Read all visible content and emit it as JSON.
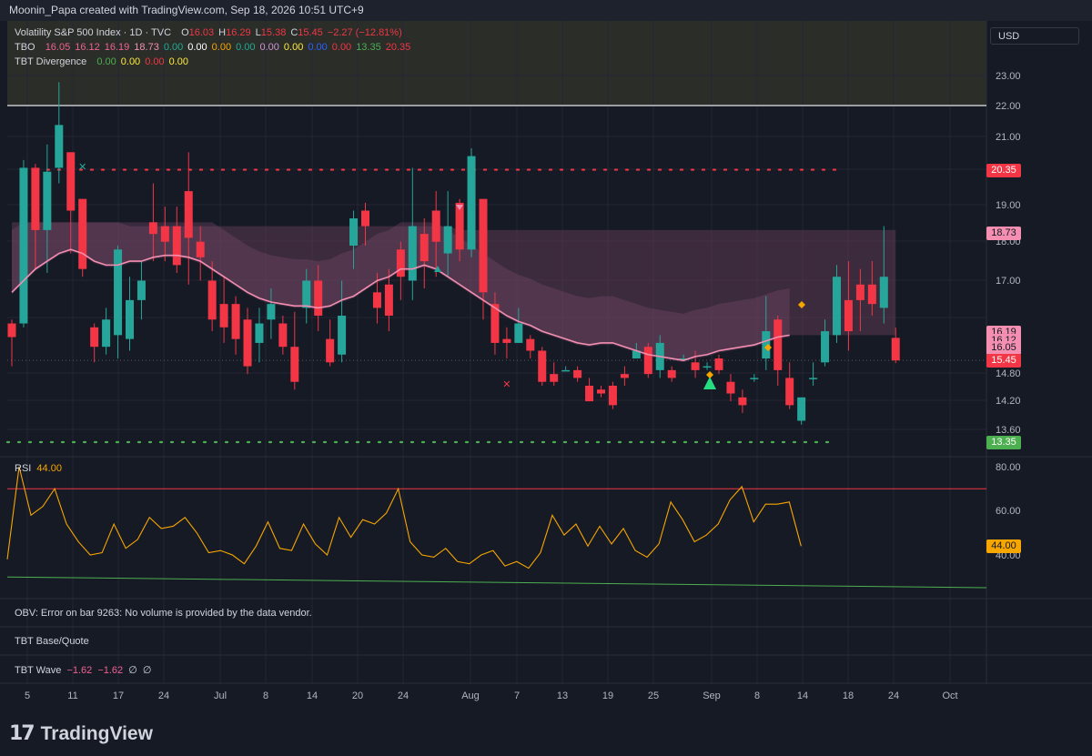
{
  "header": {
    "created_by": "Moonin_Papa created with TradingView.com, Sep 18, 2026 10:51 UTC+9"
  },
  "currency_button": "USD",
  "legend": {
    "main": {
      "title": "Volatility S&P 500 Index · 1D · TVC",
      "items": [
        {
          "label": "O",
          "value": "16.03",
          "color": "#f23645"
        },
        {
          "label": "H",
          "value": "16.29",
          "color": "#f23645"
        },
        {
          "label": "L",
          "value": "15.38",
          "color": "#f23645"
        },
        {
          "label": "C",
          "value": "15.45",
          "color": "#f23645"
        },
        {
          "label": "",
          "value": "−2.27 (−12.81%)",
          "color": "#f23645"
        }
      ]
    },
    "tbo": {
      "name": "TBO",
      "values": [
        {
          "v": "16.05",
          "color": "#f06292"
        },
        {
          "v": "16.12",
          "color": "#f06292"
        },
        {
          "v": "16.19",
          "color": "#f06292"
        },
        {
          "v": "18.73",
          "color": "#f48fb1"
        },
        {
          "v": "0.00",
          "color": "#22ab94"
        },
        {
          "v": "0.00",
          "color": "#ffffff"
        },
        {
          "v": "0.00",
          "color": "#f7a600"
        },
        {
          "v": "0.00",
          "color": "#22ab94"
        },
        {
          "v": "0.00",
          "color": "#ce93d8"
        },
        {
          "v": "0.00",
          "color": "#ffeb3b"
        },
        {
          "v": "0.00",
          "color": "#2962ff"
        },
        {
          "v": "0.00",
          "color": "#f23645"
        },
        {
          "v": "13.35",
          "color": "#4caf50"
        },
        {
          "v": "20.35",
          "color": "#f23645"
        }
      ]
    },
    "divergence": {
      "name": "TBT Divergence",
      "values": [
        {
          "v": "0.00",
          "color": "#4caf50"
        },
        {
          "v": "0.00",
          "color": "#ffeb3b"
        },
        {
          "v": "0.00",
          "color": "#f23645"
        },
        {
          "v": "0.00",
          "color": "#ffeb3b"
        }
      ]
    }
  },
  "rsi": {
    "name": "RSI",
    "value": "44.00"
  },
  "panes": {
    "obv": "OBV: Error on bar 9263: No volume is provided by the data vendor.",
    "base_quote": "TBT Base/Quote",
    "wave": {
      "name": "TBT Wave",
      "v1": "−1.62",
      "v2": "−1.62",
      "v3": "∅",
      "v4": "∅"
    }
  },
  "footer": {
    "brand": "TradingView",
    "mark": "17"
  },
  "chart_data": {
    "type": "candlestick",
    "symbol": "Volatility S&P 500 Index · 1D · TVC",
    "price_axis": {
      "ticks": [
        "23.00",
        "22.00",
        "21.00",
        "20.00",
        "19.00",
        "18.00",
        "17.00",
        "14.80",
        "14.20",
        "13.60"
      ]
    },
    "x_ticks": [
      {
        "label": "5",
        "index": 1
      },
      {
        "label": "11",
        "index": 5
      },
      {
        "label": "17",
        "index": 9
      },
      {
        "label": "24",
        "index": 13
      },
      {
        "label": "Jul",
        "index": 16
      },
      {
        "label": "8",
        "index": 20
      },
      {
        "label": "14",
        "index": 24
      },
      {
        "label": "20",
        "index": 28
      },
      {
        "label": "24",
        "index": 31
      },
      {
        "label": "Aug",
        "index": 37
      },
      {
        "label": "7",
        "index": 40
      },
      {
        "label": "13",
        "index": 44
      },
      {
        "label": "19",
        "index": 48
      },
      {
        "label": "25",
        "index": 52
      },
      {
        "label": "Sep",
        "index": 56
      },
      {
        "label": "8",
        "index": 60
      },
      {
        "label": "14",
        "index": 64
      },
      {
        "label": "18",
        "index": 67
      },
      {
        "label": "24",
        "index": 71
      },
      {
        "label": "Oct",
        "index": 76
      }
    ],
    "candles": [
      [
        16.4,
        16.05,
        16.5,
        15.3
      ],
      [
        16.4,
        20.4,
        20.6,
        16.3
      ],
      [
        20.4,
        18.8,
        20.5,
        17.8
      ],
      [
        18.8,
        20.3,
        21.0,
        17.7
      ],
      [
        20.4,
        21.5,
        22.6,
        20.0
      ],
      [
        20.8,
        19.3,
        20.8,
        18.2
      ],
      [
        19.6,
        17.8,
        19.6,
        17.6
      ],
      [
        16.3,
        15.8,
        16.4,
        15.4
      ],
      [
        15.8,
        16.5,
        16.8,
        15.6
      ],
      [
        16.1,
        18.3,
        18.4,
        15.5
      ],
      [
        16.0,
        17.0,
        17.6,
        15.7
      ],
      [
        17.0,
        17.5,
        18.0,
        16.5
      ],
      [
        19.0,
        18.7,
        20.0,
        18.0
      ],
      [
        18.9,
        18.5,
        19.4,
        18.0
      ],
      [
        18.9,
        17.9,
        19.4,
        17.7
      ],
      [
        19.8,
        18.6,
        20.8,
        17.4
      ],
      [
        18.5,
        18.1,
        18.9,
        17.5
      ],
      [
        17.5,
        16.5,
        18.0,
        16.2
      ],
      [
        16.9,
        16.3,
        17.6,
        15.9
      ],
      [
        16.9,
        16.0,
        17.1,
        15.6
      ],
      [
        16.5,
        15.3,
        16.8,
        15.1
      ],
      [
        15.9,
        16.4,
        16.8,
        15.4
      ],
      [
        16.5,
        16.9,
        17.3,
        16.0
      ],
      [
        16.4,
        15.8,
        16.6,
        15.6
      ],
      [
        15.8,
        14.9,
        16.7,
        14.7
      ],
      [
        16.8,
        17.5,
        17.8,
        16.4
      ],
      [
        17.5,
        16.6,
        17.9,
        16.2
      ],
      [
        16.0,
        15.4,
        16.5,
        15.3
      ],
      [
        15.6,
        16.6,
        17.5,
        15.4
      ],
      [
        18.4,
        19.1,
        19.3,
        17.8
      ],
      [
        19.3,
        18.9,
        19.5,
        18.4
      ],
      [
        17.2,
        16.8,
        17.7,
        16.4
      ],
      [
        17.4,
        16.6,
        17.8,
        16.2
      ],
      [
        18.3,
        17.6,
        18.5,
        17.0
      ],
      [
        17.5,
        18.9,
        20.4,
        17.0
      ],
      [
        18.7,
        18.0,
        19.1,
        17.3
      ],
      [
        19.3,
        18.5,
        19.8,
        17.6
      ],
      [
        18.2,
        18.9,
        19.8,
        17.6
      ],
      [
        19.5,
        18.3,
        19.6,
        18.0
      ],
      [
        18.3,
        20.7,
        20.9,
        18.1
      ],
      [
        19.6,
        17.2,
        19.6,
        16.5
      ],
      [
        16.9,
        15.9,
        17.2,
        15.6
      ],
      [
        16.0,
        15.9,
        16.3,
        15.5
      ],
      [
        15.9,
        16.4,
        16.8,
        15.9
      ],
      [
        16.0,
        15.7,
        16.1,
        15.5
      ],
      [
        15.7,
        14.9,
        15.8,
        14.8
      ],
      [
        15.1,
        14.9,
        15.4,
        14.8
      ],
      [
        15.2,
        15.2,
        15.3,
        15.2
      ],
      [
        15.2,
        15.0,
        15.3,
        14.9
      ],
      [
        14.8,
        14.4,
        15.0,
        14.4
      ],
      [
        14.7,
        14.6,
        14.8,
        14.5
      ],
      [
        14.8,
        14.3,
        14.9,
        14.2
      ],
      [
        15.1,
        15.0,
        15.3,
        14.8
      ],
      [
        15.5,
        15.7,
        15.9,
        15.5
      ],
      [
        15.8,
        15.1,
        15.9,
        15.0
      ],
      [
        15.2,
        15.9,
        16.1,
        15.0
      ],
      [
        15.2,
        15.0,
        15.3,
        14.9
      ],
      [
        15.5,
        15.5,
        15.6,
        15.5
      ],
      [
        15.4,
        15.2,
        15.7,
        15.0
      ],
      [
        15.3,
        15.3,
        15.4,
        15.2
      ],
      [
        15.5,
        15.2,
        15.6,
        15.1
      ],
      [
        14.9,
        14.6,
        15.1,
        14.4
      ],
      [
        14.5,
        14.3,
        14.7,
        14.1
      ],
      [
        15.0,
        15.0,
        15.1,
        14.9
      ],
      [
        15.5,
        16.2,
        17.1,
        15.2
      ],
      [
        16.5,
        15.2,
        16.6,
        14.8
      ],
      [
        15.0,
        14.3,
        15.4,
        14.2
      ],
      [
        13.9,
        14.5,
        14.5,
        13.8
      ],
      [
        15.0,
        15.0,
        15.4,
        14.8
      ],
      [
        15.4,
        16.2,
        16.5,
        15.3
      ],
      [
        16.1,
        17.6,
        17.9,
        15.9
      ],
      [
        17.0,
        16.2,
        18.0,
        15.7
      ],
      [
        17.4,
        17.0,
        17.8,
        16.2
      ],
      [
        17.4,
        16.9,
        18.0,
        16.6
      ],
      [
        16.8,
        17.6,
        18.9,
        16.4
      ],
      [
        16.03,
        15.45,
        16.29,
        15.38
      ]
    ],
    "ma_line": [
      17.2,
      17.5,
      17.8,
      18.0,
      18.2,
      18.3,
      18.2,
      18.0,
      17.9,
      17.9,
      18.0,
      18.0,
      18.1,
      18.15,
      18.15,
      18.1,
      18.0,
      17.8,
      17.6,
      17.4,
      17.2,
      17.05,
      16.95,
      16.9,
      16.85,
      16.85,
      16.8,
      16.85,
      17.0,
      17.1,
      17.3,
      17.5,
      17.6,
      17.8,
      17.8,
      17.9,
      17.8,
      17.6,
      17.4,
      17.2,
      17.0,
      16.8,
      16.6,
      16.45,
      16.35,
      16.2,
      16.1,
      16.0,
      15.9,
      15.85,
      15.9,
      15.9,
      15.8,
      15.7,
      15.6,
      15.55,
      15.5,
      15.45,
      15.55,
      15.6,
      15.7,
      15.75,
      15.8,
      15.85,
      15.95,
      16.05,
      16.1
    ],
    "resistance_line": 20.35,
    "support_line": 13.35,
    "white_line": 22.0,
    "rsi": {
      "ticks": [
        "80.00",
        "60.00",
        "40.00"
      ],
      "upper_band": 70,
      "lower_band": 30,
      "values": [
        38,
        80,
        58,
        62,
        70,
        54,
        46,
        40,
        41,
        54,
        43,
        47,
        57,
        52,
        53,
        57,
        50,
        41,
        42,
        40,
        36,
        44,
        55,
        43,
        42,
        54,
        45,
        40,
        57,
        48,
        56,
        54,
        59,
        70,
        46,
        40,
        39,
        43,
        37,
        36,
        40,
        42,
        35,
        37,
        34,
        41,
        58,
        49,
        54,
        44,
        53,
        45,
        52,
        42,
        39,
        45,
        64,
        56,
        46,
        49,
        54,
        65,
        71,
        55,
        63,
        63,
        64,
        44
      ]
    },
    "price_labels": [
      {
        "value": "20.35",
        "bg": "#f23645",
        "fg": "#ffffff",
        "y": 20.35
      },
      {
        "value": "18.73",
        "bg": "#f48fb1",
        "fg": "#131722",
        "y": 18.73
      },
      {
        "value": "16.19",
        "bg": "#f48fb1",
        "fg": "#131722",
        "y": 16.19
      },
      {
        "value": "16.12",
        "bg": "#f48fb1",
        "fg": "#131722",
        "y": 15.98
      },
      {
        "value": "16.05",
        "bg": "#f48fb1",
        "fg": "#131722",
        "y": 15.77
      },
      {
        "value": "15.45",
        "bg": "#f23645",
        "fg": "#ffffff",
        "y": 15.45
      },
      {
        "value": "13.35",
        "bg": "#4caf50",
        "fg": "#ffffff",
        "y": 13.35
      }
    ],
    "rsi_label": {
      "value": "44.00",
      "bg": "#f7a600",
      "fg": "#131722"
    },
    "colors": {
      "up": "#26a69a",
      "down": "#f23645",
      "ma": "#f48fb1",
      "band": "#5d3a52",
      "rsi": "#f7a600",
      "bg": "#161a25",
      "grid": "#242733"
    }
  }
}
